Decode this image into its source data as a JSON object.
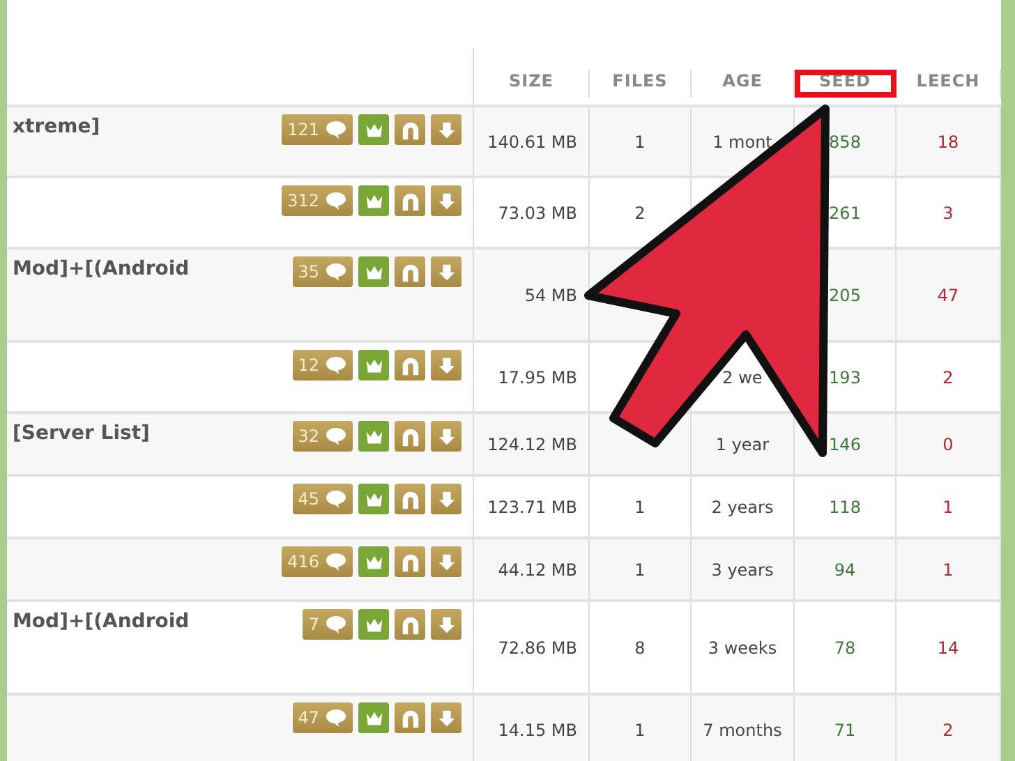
{
  "table": {
    "columns": [
      {
        "label": "SIZE",
        "highlighted": false
      },
      {
        "label": "FILES",
        "highlighted": false
      },
      {
        "label": "AGE",
        "highlighted": false
      },
      {
        "label": "SEED",
        "highlighted": true
      },
      {
        "label": "LEECH",
        "highlighted": false
      }
    ],
    "rows": [
      {
        "title": "xtreme]",
        "comments": "121",
        "size": "140.61 MB",
        "files": "1",
        "age": "1 mont",
        "seed": "858",
        "leech": "18"
      },
      {
        "comments": "312",
        "size": "73.03 MB",
        "files": "2",
        "seed": "261",
        "leech": "3"
      },
      {
        "title": "Mod]+[(Android",
        "comments": "35",
        "size": "54 MB",
        "seed": "205",
        "leech": "47"
      },
      {
        "comments": "12",
        "size": "17.95 MB",
        "age": "2 we",
        "seed": "193",
        "leech": "2"
      },
      {
        "title": "[Server List]",
        "comments": "32",
        "size": "124.12 MB",
        "age": "1 year",
        "seed": "146",
        "leech": "0"
      },
      {
        "comments": "45",
        "size": "123.71 MB",
        "files": "1",
        "age": "2 years",
        "seed": "118",
        "leech": "1"
      },
      {
        "comments": "416",
        "size": "44.12 MB",
        "files": "1",
        "age": "3 years",
        "seed": "94",
        "leech": "1"
      },
      {
        "title": "Mod]+[(Android",
        "comments": "7",
        "size": "72.86 MB",
        "files": "8",
        "age": "3 weeks",
        "seed": "78",
        "leech": "14"
      },
      {
        "comments": "47",
        "size": "14.15 MB",
        "files": "1",
        "age": "7 months",
        "seed": "71",
        "leech": "2"
      }
    ]
  },
  "annotation": {
    "kind": "arrow"
  }
}
